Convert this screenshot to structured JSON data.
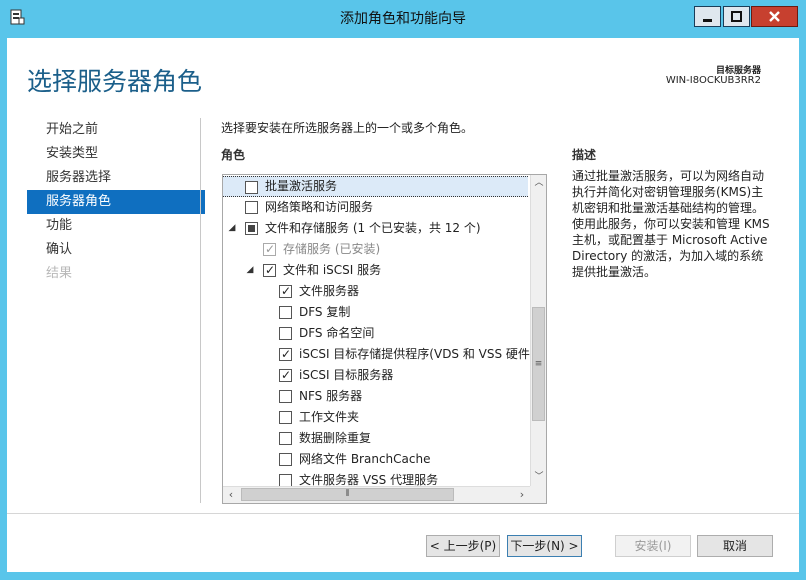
{
  "window": {
    "title": "添加角色和功能向导"
  },
  "header": {
    "page_title": "选择服务器角色",
    "target_label": "目标服务器",
    "target_value": "WIN-I8OCKUB3RR2"
  },
  "nav": {
    "items": [
      {
        "label": "开始之前",
        "state": "normal"
      },
      {
        "label": "安装类型",
        "state": "normal"
      },
      {
        "label": "服务器选择",
        "state": "normal"
      },
      {
        "label": "服务器角色",
        "state": "active"
      },
      {
        "label": "功能",
        "state": "normal"
      },
      {
        "label": "确认",
        "state": "normal"
      },
      {
        "label": "结果",
        "state": "disabled"
      }
    ]
  },
  "main": {
    "instruction": "选择要安装在所选服务器上的一个或多个角色。",
    "roles_heading": "角色",
    "roles": [
      {
        "label": "批量激活服务",
        "level": 0,
        "check": "unchecked",
        "selected": true
      },
      {
        "label": "网络策略和访问服务",
        "level": 0,
        "check": "unchecked"
      },
      {
        "label": "文件和存储服务 (1 个已安装，共 12 个)",
        "level": 0,
        "check": "partial",
        "expander": "◢"
      },
      {
        "label": "存储服务 (已安装)",
        "level": 1,
        "check": "checked",
        "gray": true
      },
      {
        "label": "文件和 iSCSI 服务",
        "level": 1,
        "check": "checked",
        "expander": "◢"
      },
      {
        "label": "文件服务器",
        "level": 2,
        "check": "checked"
      },
      {
        "label": "DFS 复制",
        "level": 2,
        "check": "unchecked"
      },
      {
        "label": "DFS 命名空间",
        "level": 2,
        "check": "unchecked"
      },
      {
        "label": "iSCSI 目标存储提供程序(VDS 和 VSS 硬件提",
        "level": 2,
        "check": "checked"
      },
      {
        "label": "iSCSI 目标服务器",
        "level": 2,
        "check": "checked"
      },
      {
        "label": "NFS 服务器",
        "level": 2,
        "check": "unchecked"
      },
      {
        "label": "工作文件夹",
        "level": 2,
        "check": "unchecked"
      },
      {
        "label": "数据删除重复",
        "level": 2,
        "check": "unchecked"
      },
      {
        "label": "网络文件 BranchCache",
        "level": 2,
        "check": "unchecked"
      },
      {
        "label": "文件服务器 VSS 代理服务",
        "level": 2,
        "check": "unchecked"
      }
    ],
    "vscroll_position": 0.3,
    "description_heading": "描述",
    "description": "通过批量激活服务，可以为网络自动执行并简化对密钥管理服务(KMS)主机密钥和批量激活基础结构的管理。使用此服务，你可以安装和管理 KMS 主机，或配置基于 Microsoft Active Directory 的激活，为加入域的系统提供批量激活。"
  },
  "footer": {
    "prev": "< 上一步(P)",
    "next": "下一步(N) >",
    "install": "安装(I)",
    "cancel": "取消"
  },
  "colors": {
    "accent": "#0f6fc0",
    "chrome": "#59c5ea",
    "title": "#1b5f8a"
  }
}
